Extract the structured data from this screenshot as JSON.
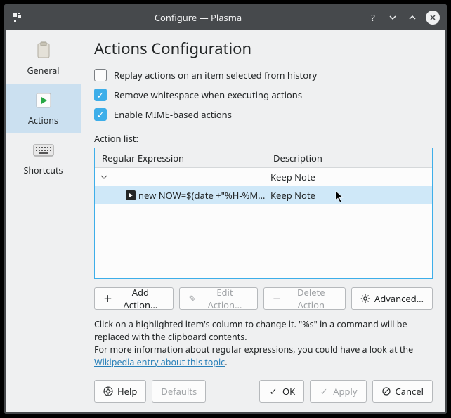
{
  "window": {
    "title": "Configure — Plasma"
  },
  "sidebar": {
    "items": [
      {
        "label": "General"
      },
      {
        "label": "Actions"
      },
      {
        "label": "Shortcuts"
      }
    ]
  },
  "main": {
    "heading": "Actions Configuration",
    "checks": {
      "replay": "Replay actions on an item selected from history",
      "whitespace": "Remove whitespace when executing actions",
      "mime": "Enable MIME-based actions"
    },
    "action_list_label": "Action list:",
    "columns": {
      "regex": "Regular Expression",
      "desc": "Description"
    },
    "rows": {
      "parent": {
        "regex": "",
        "desc": "Keep Note"
      },
      "child": {
        "regex": "new NOW=$(date +\"%H-%M…",
        "desc": "Keep Note"
      }
    },
    "buttons": {
      "add": "Add Action…",
      "edit": "Edit Action…",
      "delete": "Delete Action",
      "advanced": "Advanced…"
    },
    "helptext": {
      "line1": "Click on a highlighted item's column to change it. \"%s\" in a command will be replaced with the clipboard contents.",
      "line2_pre": "For more information about regular expressions, you could have a look at the ",
      "link": "Wikipedia entry about this topic",
      "line2_post": "."
    }
  },
  "footer": {
    "help": "Help",
    "defaults": "Defaults",
    "ok": "OK",
    "apply": "Apply",
    "cancel": "Cancel"
  }
}
